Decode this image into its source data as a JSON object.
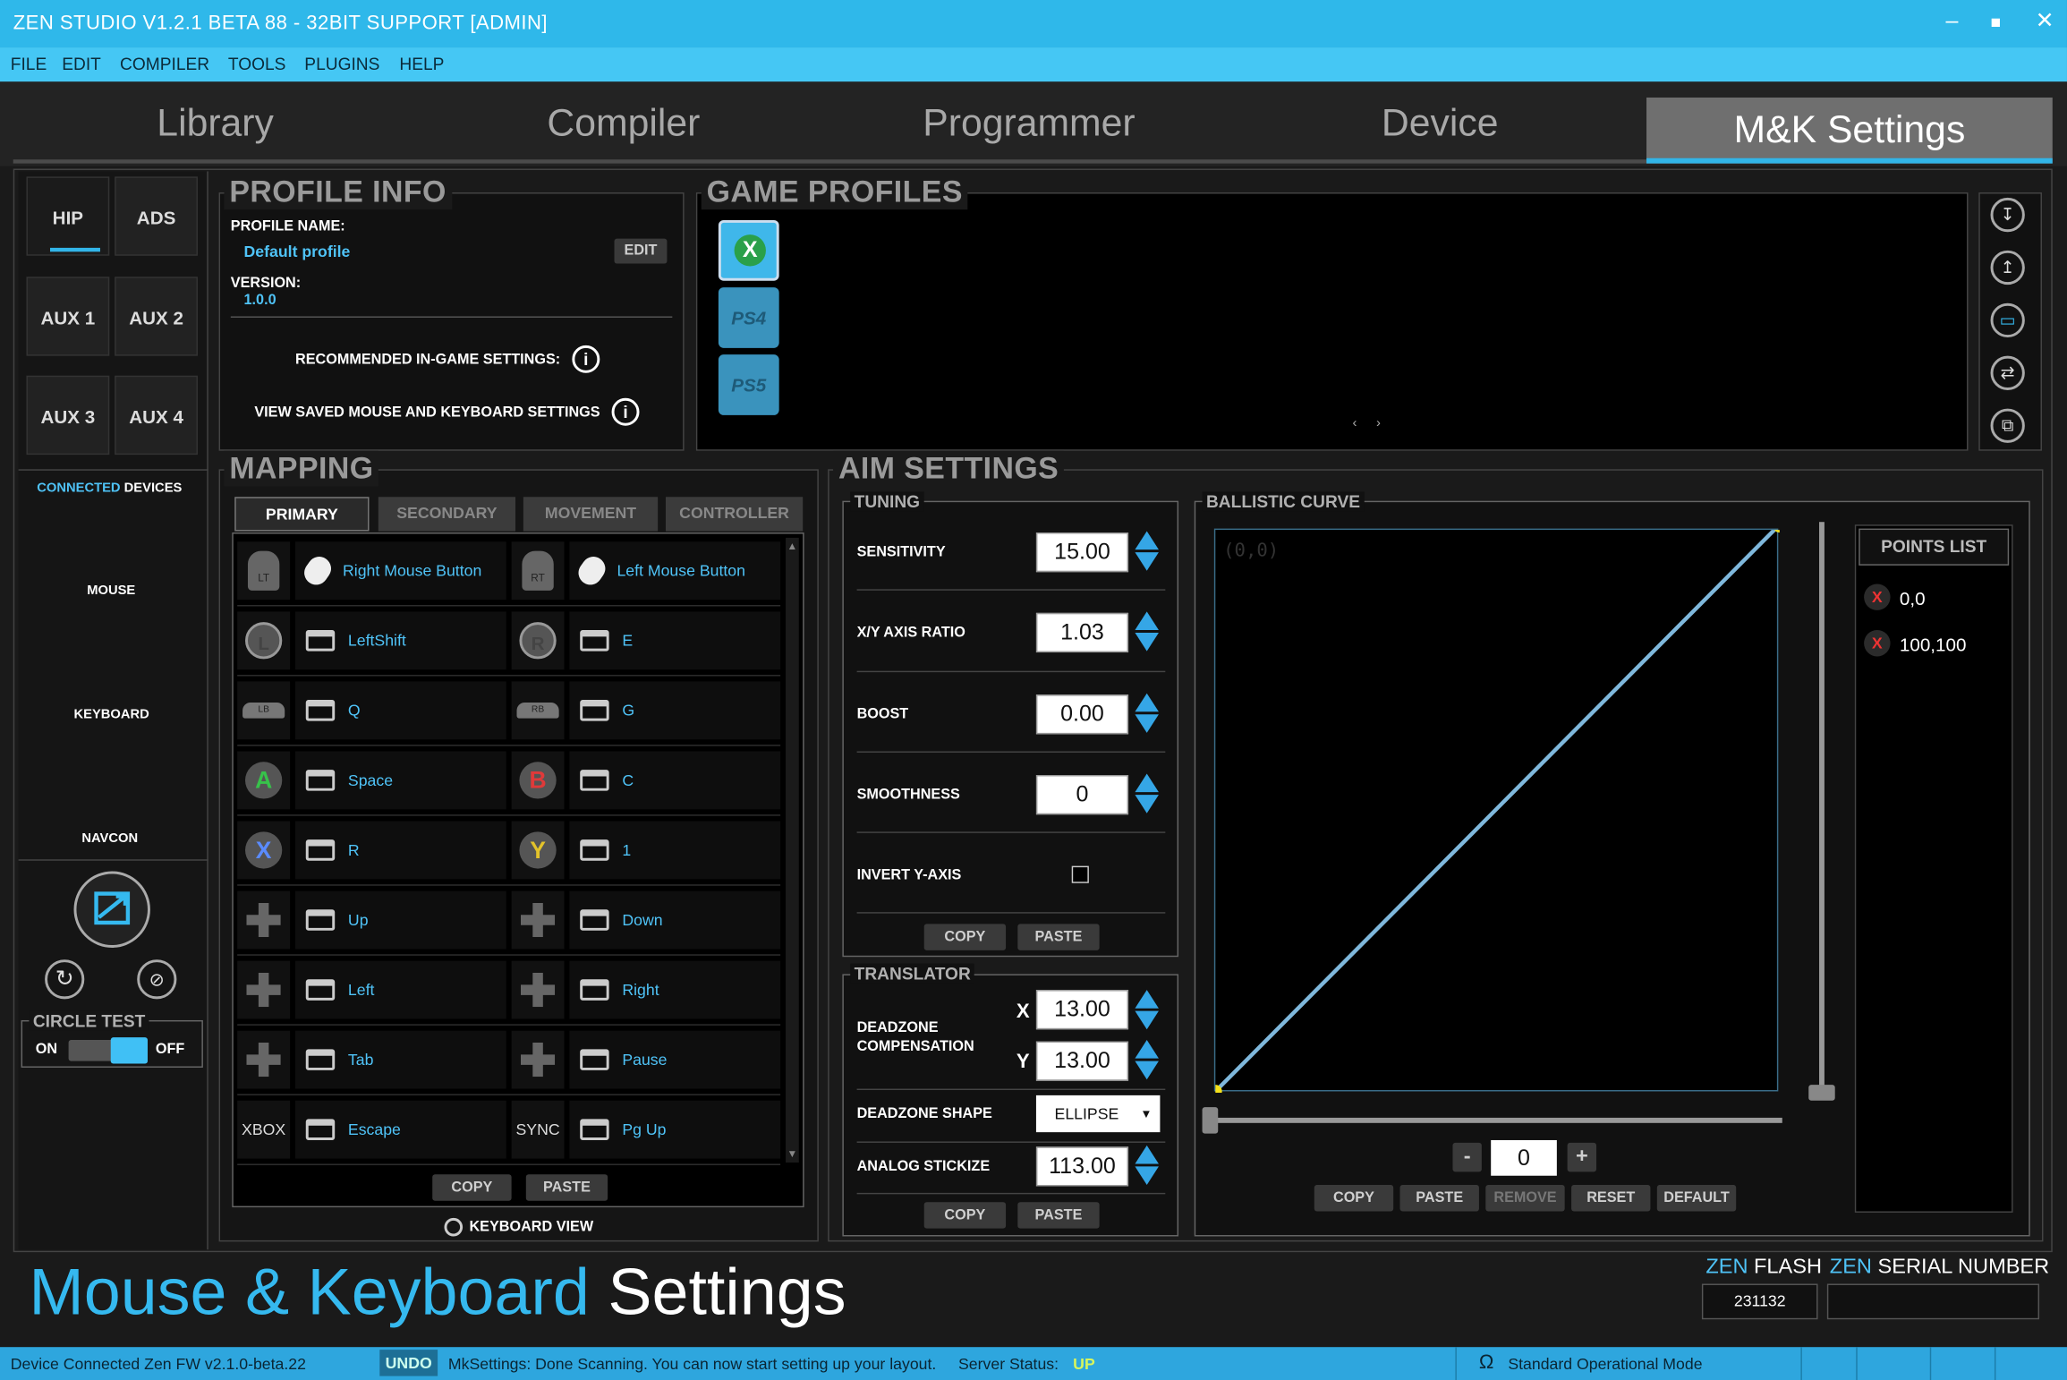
{
  "window": {
    "title": "ZEN STUDIO V1.2.1 BETA 88 - 32BIT SUPPORT [ADMIN]"
  },
  "menu": [
    "FILE",
    "EDIT",
    "COMPILER",
    "TOOLS",
    "PLUGINS",
    "HELP"
  ],
  "tabs": [
    "Library",
    "Compiler",
    "Programmer",
    "Device",
    "M&K Settings"
  ],
  "side": {
    "modes": [
      "HIP",
      "ADS",
      "AUX 1",
      "AUX 2",
      "AUX 3",
      "AUX 4"
    ],
    "connected": "CONNECTED",
    "devices": "DEVICES",
    "items": [
      "MOUSE",
      "KEYBOARD",
      "NAVCON"
    ],
    "circle_test": "CIRCLE TEST",
    "on": "ON",
    "off": "OFF"
  },
  "profile": {
    "section": "PROFILE INFO",
    "name_label": "PROFILE NAME:",
    "name_value": "Default profile",
    "edit": "EDIT",
    "version_label": "VERSION:",
    "version_value": "1.0.0",
    "recommended": "RECOMMENDED IN-GAME SETTINGS:",
    "view_saved": "VIEW SAVED MOUSE AND KEYBOARD SETTINGS"
  },
  "game_profiles": {
    "section": "GAME PROFILES",
    "ps4": "PS4",
    "ps5": "PS5"
  },
  "mapping": {
    "section": "MAPPING",
    "subtabs": [
      "PRIMARY",
      "SECONDARY",
      "MOVEMENT",
      "CONTROLLER"
    ],
    "rows": [
      {
        "l_icon": "LT",
        "l_key": "Right Mouse Button",
        "r_icon": "RT",
        "r_key": "Left Mouse Button"
      },
      {
        "l_icon": "L",
        "l_key": "LeftShift",
        "r_icon": "R",
        "r_key": "E"
      },
      {
        "l_icon": "LB",
        "l_key": "Q",
        "r_icon": "RB",
        "r_key": "G"
      },
      {
        "l_icon": "A",
        "l_key": "Space",
        "r_icon": "B",
        "r_key": "C"
      },
      {
        "l_icon": "X",
        "l_key": "R",
        "r_icon": "Y",
        "r_key": "1"
      },
      {
        "l_icon": "",
        "l_key": "Up",
        "r_icon": "",
        "r_key": "Down"
      },
      {
        "l_icon": "",
        "l_key": "Left",
        "r_icon": "",
        "r_key": "Right"
      },
      {
        "l_icon": "",
        "l_key": "Tab",
        "r_icon": "",
        "r_key": "Pause"
      },
      {
        "l_icon": "XBOX",
        "l_key": "Escape",
        "r_icon": "SYNC",
        "r_key": "Pg Up"
      }
    ],
    "copy": "COPY",
    "paste": "PASTE",
    "keyboard_view": "KEYBOARD VIEW"
  },
  "aim": {
    "section": "AIM SETTINGS",
    "tuning": "TUNING",
    "sensitivity_label": "SENSITIVITY",
    "sensitivity": "15.00",
    "xy_label": "X/Y AXIS RATIO",
    "xy": "1.03",
    "boost_label": "BOOST",
    "boost": "0.00",
    "smooth_label": "SMOOTHNESS",
    "smooth": "0",
    "invert_label": "INVERT Y-AXIS",
    "copy": "COPY",
    "paste": "PASTE",
    "translator": "TRANSLATOR",
    "dz_label": "DEADZONE COMPENSATION",
    "dz_x_label": "X",
    "dz_x": "13.00",
    "dz_y_label": "Y",
    "dz_y": "13.00",
    "shape_label": "DEADZONE SHAPE",
    "shape": "ELLIPSE",
    "stick_label": "ANALOG STICKIZE",
    "stick": "113.00"
  },
  "ballistic": {
    "section": "BALLISTIC CURVE",
    "origin": "(0,0)",
    "points_title": "POINTS LIST",
    "points": [
      "0,0",
      "100,100"
    ],
    "value": "0",
    "minus": "-",
    "plus": "+",
    "buttons": [
      "COPY",
      "PASTE",
      "REMOVE",
      "RESET",
      "DEFAULT"
    ]
  },
  "footer": {
    "title_a": "Mouse & Keyboard",
    "title_b": "Settings",
    "zen1": "ZEN",
    "flash": "FLASH",
    "zen2": "ZEN",
    "serial": "SERIAL NUMBER",
    "flash_value": "231132"
  },
  "status": {
    "device": "Device Connected Zen FW v2.1.0-beta.22",
    "undo": "UNDO",
    "msg": "MkSettings: Done Scanning. You can now start setting up your layout.",
    "server": "Server Status:",
    "up": "UP",
    "mode": "Standard Operational Mode"
  }
}
